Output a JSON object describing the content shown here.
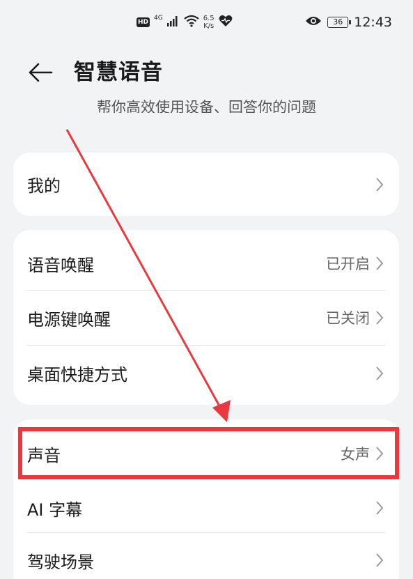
{
  "status_bar": {
    "hd": "HD",
    "network": "4G",
    "speed_value": "6.5",
    "speed_unit": "K/s",
    "battery": "36",
    "time": "12:43",
    "icons": [
      "signal-icon",
      "wifi-icon",
      "heart-rate-icon",
      "eye-icon"
    ]
  },
  "header": {
    "title": "智慧语音",
    "subtitle": "帮你高效使用设备、回答你的问题"
  },
  "cards": [
    {
      "rows": [
        {
          "label": "我的",
          "value": ""
        }
      ]
    },
    {
      "rows": [
        {
          "label": "语音唤醒",
          "value": "已开启"
        },
        {
          "label": "电源键唤醒",
          "value": "已关闭"
        },
        {
          "label": "桌面快捷方式",
          "value": ""
        }
      ]
    },
    {
      "rows": [
        {
          "label": "声音",
          "value": "女声"
        },
        {
          "label": "AI 字幕",
          "value": ""
        },
        {
          "label": "驾驶场景",
          "value": ""
        }
      ]
    }
  ],
  "annotation": {
    "highlight_color": "#e8393e",
    "highlighted_row": "声音"
  }
}
